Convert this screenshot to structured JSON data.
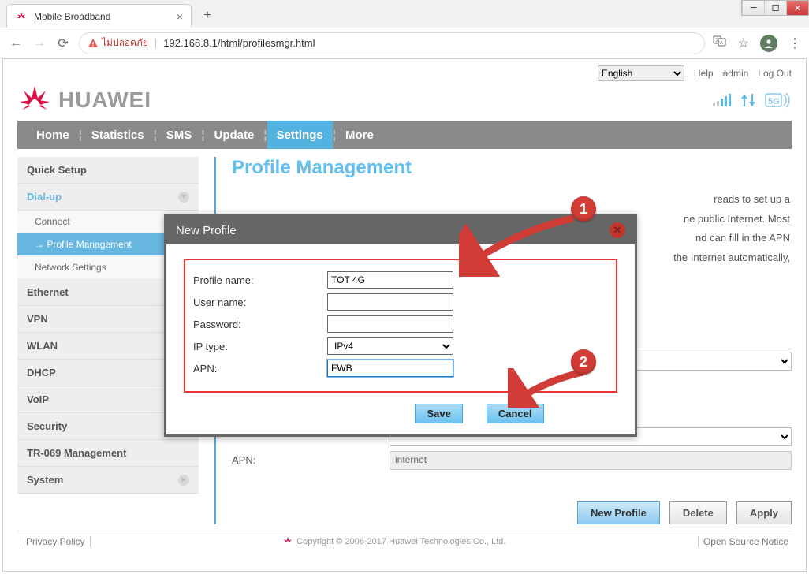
{
  "browser": {
    "tab_title": "Mobile Broadband",
    "url": "192.168.8.1/html/profilesmgr.html",
    "security_label": "ไม่ปลอดภัย"
  },
  "top": {
    "language": "English",
    "languages": [
      "English"
    ],
    "help": "Help",
    "admin": "admin",
    "logout": "Log Out"
  },
  "brand": {
    "name": "HUAWEI"
  },
  "nav": {
    "items": [
      "Home",
      "Statistics",
      "SMS",
      "Update",
      "Settings",
      "More"
    ],
    "active_index": 4
  },
  "sidebar": {
    "items": [
      {
        "label": "Quick Setup",
        "type": "item"
      },
      {
        "label": "Dial-up",
        "type": "item-open"
      },
      {
        "label": "Connect",
        "type": "sub"
      },
      {
        "label": "Profile Management",
        "type": "sub-active"
      },
      {
        "label": "Network Settings",
        "type": "sub"
      },
      {
        "label": "Ethernet",
        "type": "item"
      },
      {
        "label": "VPN",
        "type": "item"
      },
      {
        "label": "WLAN",
        "type": "item"
      },
      {
        "label": "DHCP",
        "type": "item"
      },
      {
        "label": "VoIP",
        "type": "item"
      },
      {
        "label": "Security",
        "type": "item"
      },
      {
        "label": "TR-069 Management",
        "type": "item"
      },
      {
        "label": "System",
        "type": "item-chev"
      }
    ]
  },
  "main": {
    "title": "Profile Management",
    "intro_tail": "reads to set up a public Internet. Most can fill in the APN Internet automatically,",
    "apn_label": "APN:",
    "apn_value": "internet",
    "buttons": {
      "new_profile": "New Profile",
      "delete": "Delete",
      "apply": "Apply"
    }
  },
  "modal": {
    "title": "New Profile",
    "fields": {
      "profile_name": {
        "label": "Profile name:",
        "value": "TOT 4G"
      },
      "user_name": {
        "label": "User name:",
        "value": ""
      },
      "password": {
        "label": "Password:",
        "value": ""
      },
      "ip_type": {
        "label": "IP type:",
        "value": "IPv4",
        "options": [
          "IPv4"
        ]
      },
      "apn": {
        "label": "APN:",
        "value": "FWB"
      }
    },
    "save": "Save",
    "cancel": "Cancel"
  },
  "footer": {
    "privacy": "Privacy Policy",
    "copyright": "Copyright © 2006-2017 Huawei Technologies Co., Ltd.",
    "oss": "Open Source Notice"
  },
  "annotations": {
    "badge1": "1",
    "badge2": "2"
  }
}
